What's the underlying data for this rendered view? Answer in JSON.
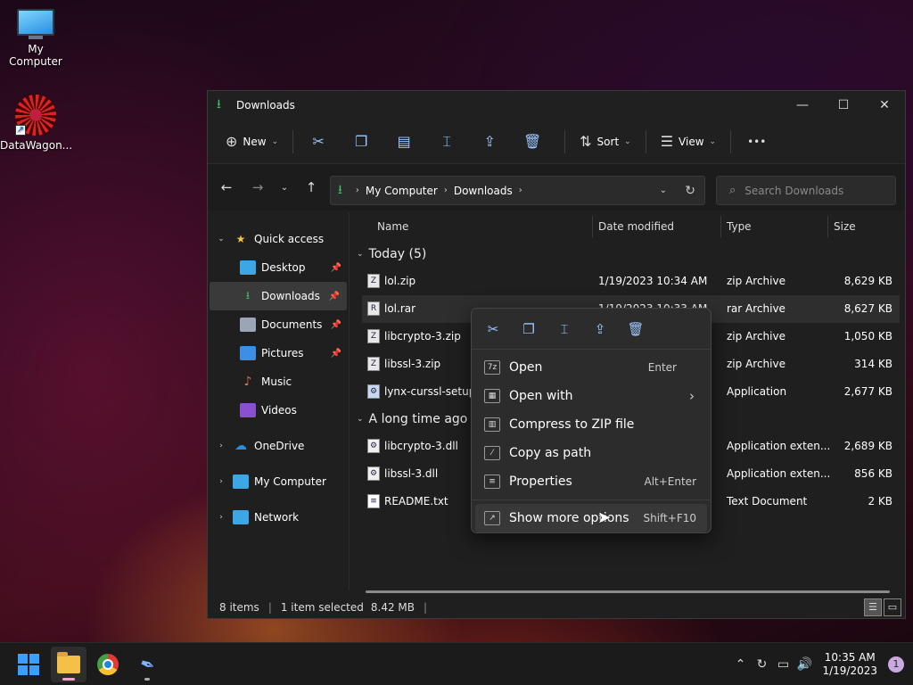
{
  "desktop": {
    "icons": [
      {
        "label": "My Computer"
      },
      {
        "label": "DataWagon..."
      }
    ]
  },
  "window": {
    "title": "Downloads",
    "controls": {
      "minimize": "—",
      "maximize": "☐",
      "close": "✕"
    }
  },
  "toolbar": {
    "new_label": "New",
    "sort_label": "Sort",
    "view_label": "View",
    "more_label": "•••"
  },
  "address": {
    "crumbs": [
      "My Computer",
      "Downloads"
    ],
    "search_placeholder": "Search Downloads"
  },
  "sidebar": {
    "items": [
      {
        "label": "Quick access",
        "icon": "star-icon",
        "color": "#f6c343"
      },
      {
        "label": "Desktop",
        "icon": "desktop-icon",
        "color": "#3ba7e6"
      },
      {
        "label": "Downloads",
        "icon": "download-icon",
        "color": "#3cc06c"
      },
      {
        "label": "Documents",
        "icon": "document-icon",
        "color": "#9aa5b8"
      },
      {
        "label": "Pictures",
        "icon": "pictures-icon",
        "color": "#3b8fe6"
      },
      {
        "label": "Music",
        "icon": "music-icon",
        "color": "#e07050"
      },
      {
        "label": "Videos",
        "icon": "videos-icon",
        "color": "#8a50d0"
      },
      {
        "label": "OneDrive",
        "icon": "cloud-icon",
        "color": "#2a8ee0"
      },
      {
        "label": "My Computer",
        "icon": "computer-icon",
        "color": "#3ba7e6"
      },
      {
        "label": "Network",
        "icon": "network-icon",
        "color": "#3ba7e6"
      }
    ]
  },
  "columns": {
    "name": "Name",
    "date": "Date modified",
    "type": "Type",
    "size": "Size"
  },
  "groups": {
    "today": "Today (5)",
    "older": "A long time ago ("
  },
  "files": [
    {
      "name": "lol.zip",
      "date": "1/19/2023 10:34 AM",
      "type": "zip Archive",
      "size": "8,629 KB"
    },
    {
      "name": "lol.rar",
      "date": "1/19/2023 10:33 AM",
      "type": "rar Archive",
      "size": "8,627 KB"
    },
    {
      "name": "libcrypto-3.zip",
      "date": "",
      "type": "zip Archive",
      "size": "1,050 KB"
    },
    {
      "name": "libssl-3.zip",
      "date": "",
      "type": "zip Archive",
      "size": "314 KB"
    },
    {
      "name": "lynx-curssl-setup.e",
      "date": "",
      "type": "Application",
      "size": "2,677 KB"
    },
    {
      "name": "libcrypto-3.dll",
      "date": "",
      "type": "Application exten...",
      "size": "2,689 KB"
    },
    {
      "name": "libssl-3.dll",
      "date": "",
      "type": "Application exten...",
      "size": "856 KB"
    },
    {
      "name": "README.txt",
      "date": "",
      "type": "Text Document",
      "size": "2 KB"
    }
  ],
  "status": {
    "items": "8 items",
    "selected": "1 item selected",
    "size": "8.42 MB"
  },
  "context_menu": {
    "items": [
      {
        "label": "Open",
        "shortcut": "Enter"
      },
      {
        "label": "Open with",
        "shortcut": "›"
      },
      {
        "label": "Compress to ZIP file",
        "shortcut": ""
      },
      {
        "label": "Copy as path",
        "shortcut": ""
      },
      {
        "label": "Properties",
        "shortcut": "Alt+Enter"
      },
      {
        "label": "Show more options",
        "shortcut": "Shift+F10"
      }
    ]
  },
  "taskbar": {
    "time": "10:35 AM",
    "date": "1/19/2023",
    "notifications": "1"
  }
}
